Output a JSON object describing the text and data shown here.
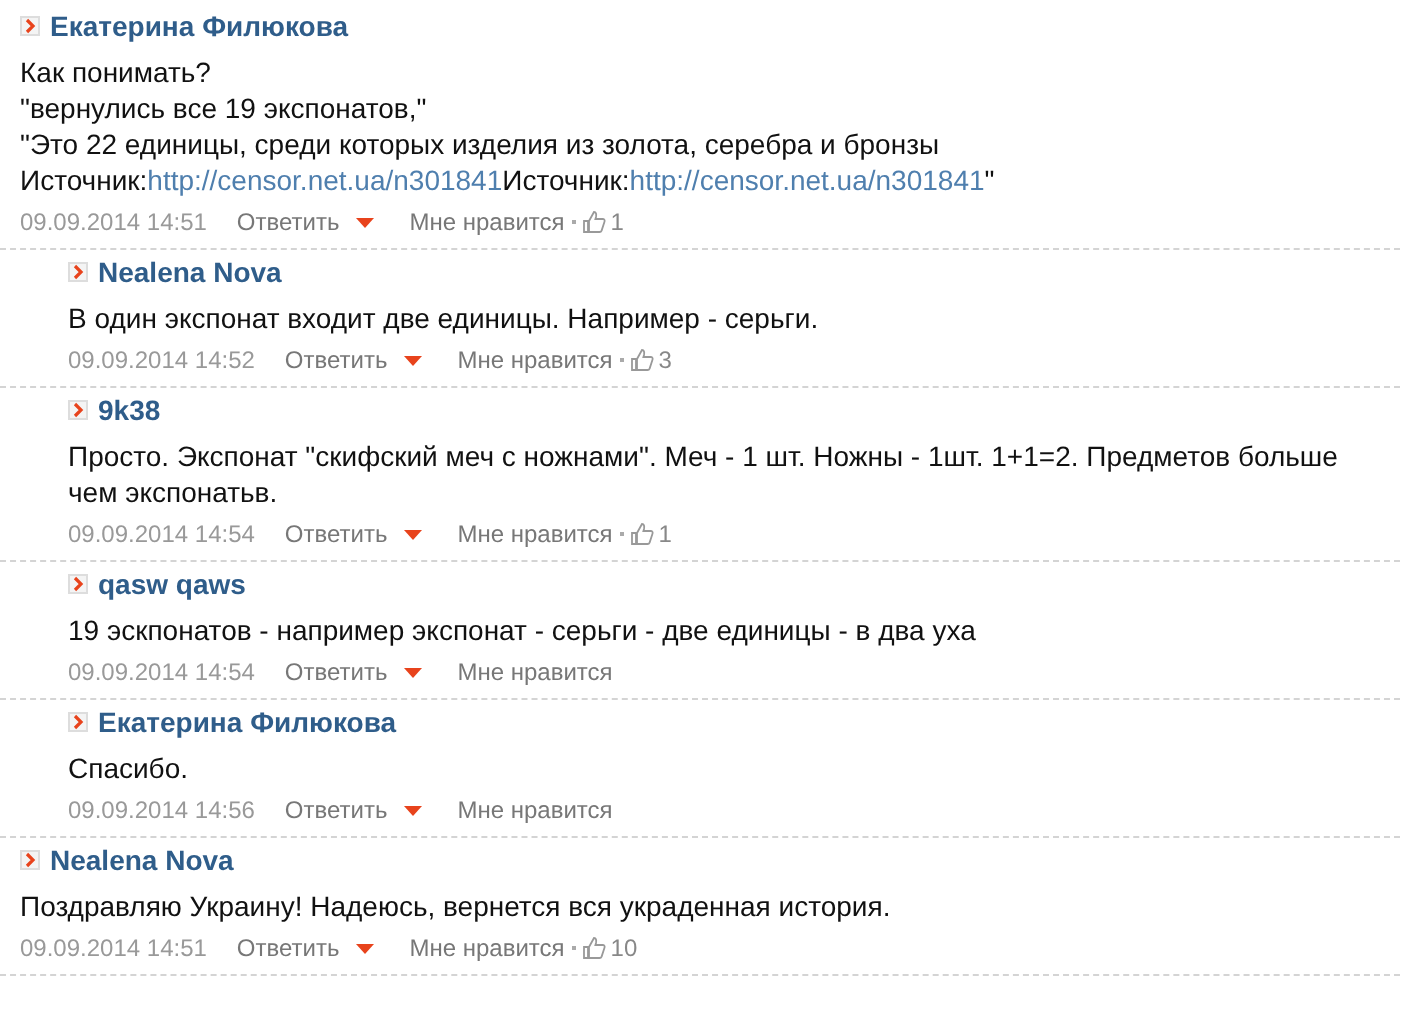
{
  "comments": [
    {
      "author": "Екатерина Филюкова",
      "text": [
        [
          {
            "kind": "text",
            "text": "Как понимать?"
          }
        ],
        [
          {
            "kind": "text",
            "text": "\"вернулись все 19 экспонатов,\""
          }
        ],
        [
          {
            "kind": "text",
            "text": "\"Это 22 единицы, среди которых изделия из золота, серебра и бронзы"
          }
        ],
        [
          {
            "kind": "text",
            "text": "Источник:"
          },
          {
            "kind": "link",
            "text": "http://censor.net.ua/n301841"
          },
          {
            "kind": "text",
            "text": "Источник:"
          },
          {
            "kind": "link",
            "text": "http://censor.net.ua/n301841"
          },
          {
            "kind": "text",
            "text": "\""
          }
        ]
      ],
      "date": "09.09.2014 14:51",
      "reply": "Ответить",
      "like": "Мне нравится",
      "likes": "1",
      "children": [
        {
          "author": "Nealena Nova",
          "text": [
            [
              {
                "kind": "text",
                "text": "В один экспонат входит две единицы. Например - серьги."
              }
            ]
          ],
          "date": "09.09.2014 14:52",
          "reply": "Ответить",
          "like": "Мне нравится",
          "likes": "3"
        },
        {
          "author": "9k38",
          "text": [
            [
              {
                "kind": "text",
                "text": "Просто. Экспонат \"скифский меч с ножнами\". Меч - 1 шт. Ножны - 1шт. 1+1=2. Предметов больше"
              }
            ],
            [
              {
                "kind": "text",
                "text": "чем экспонатьв."
              }
            ]
          ],
          "date": "09.09.2014 14:54",
          "reply": "Ответить",
          "like": "Мне нравится",
          "likes": "1"
        },
        {
          "author": "qasw qaws",
          "text": [
            [
              {
                "kind": "text",
                "text": "19 эскпонатов - например экспонат - серьги - две единицы - в два уха"
              }
            ]
          ],
          "date": "09.09.2014 14:54",
          "reply": "Ответить",
          "like": "Мне нравится"
        },
        {
          "author": "Екатерина Филюкова",
          "text": [
            [
              {
                "kind": "text",
                "text": "Спасибо."
              }
            ]
          ],
          "date": "09.09.2014 14:56",
          "reply": "Ответить",
          "like": "Мне нравится"
        }
      ]
    },
    {
      "author": "Nealena Nova",
      "text": [
        [
          {
            "kind": "text",
            "text": "Поздравляю Украину! Надеюсь, вернется вся украденная история."
          }
        ]
      ],
      "date": "09.09.2014 14:51",
      "reply": "Ответить",
      "like": "Мне нравится",
      "likes": "10"
    }
  ]
}
